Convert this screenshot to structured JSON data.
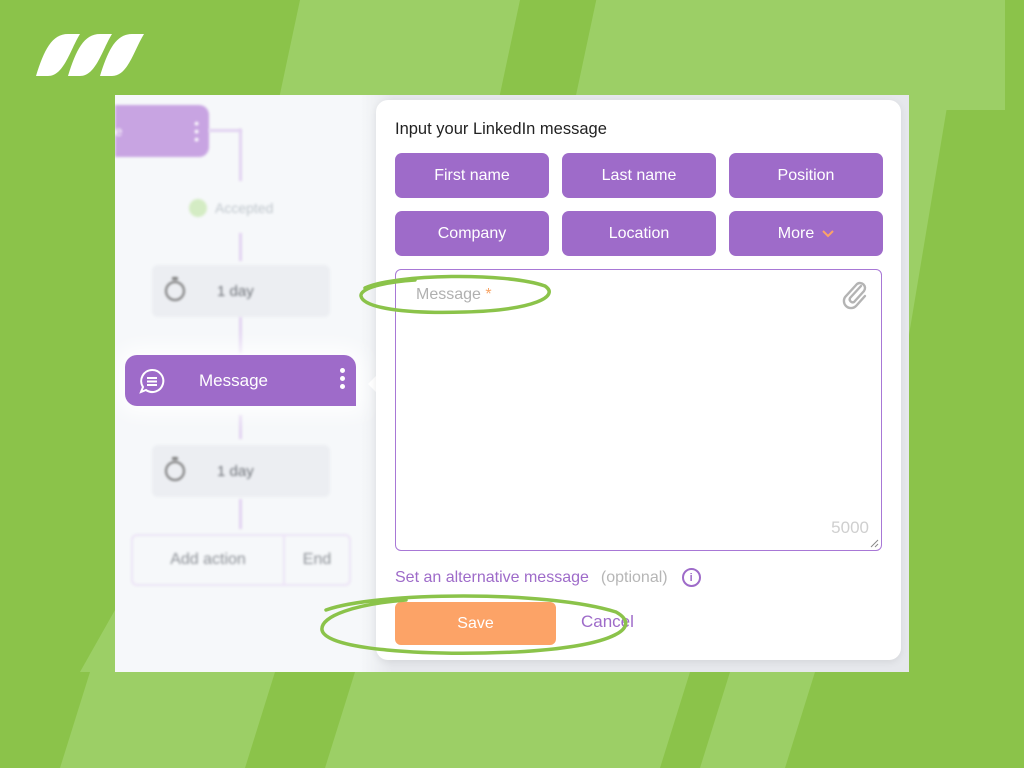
{
  "brand": {
    "logo": "brand-stripes-logo",
    "accent": "#8bc34a"
  },
  "workflow": {
    "top_node_label": "Invite",
    "accepted_label": "Accepted",
    "delay_1": "1 day",
    "message_node_label": "Message",
    "delay_2": "1 day",
    "add_action_label": "Add action",
    "end_label": "End"
  },
  "panel": {
    "title": "Input your LinkedIn message",
    "variables": [
      {
        "label": "First name"
      },
      {
        "label": "Last name"
      },
      {
        "label": "Position"
      },
      {
        "label": "Company"
      },
      {
        "label": "Location"
      },
      {
        "label": "More"
      }
    ],
    "message": {
      "value": "",
      "placeholder": "Message",
      "required_mark": "*",
      "char_limit": "5000",
      "attach_icon": "paperclip-icon"
    },
    "alternative": {
      "link": "Set an alternative message",
      "optional": "(optional)",
      "info": "i"
    },
    "save_label": "Save",
    "cancel_label": "Cancel"
  },
  "colors": {
    "primary_purple": "#9e6bc9",
    "save_orange": "#fca367",
    "background_green": "#8bc34a",
    "highlight_green": "#8bc34a"
  }
}
